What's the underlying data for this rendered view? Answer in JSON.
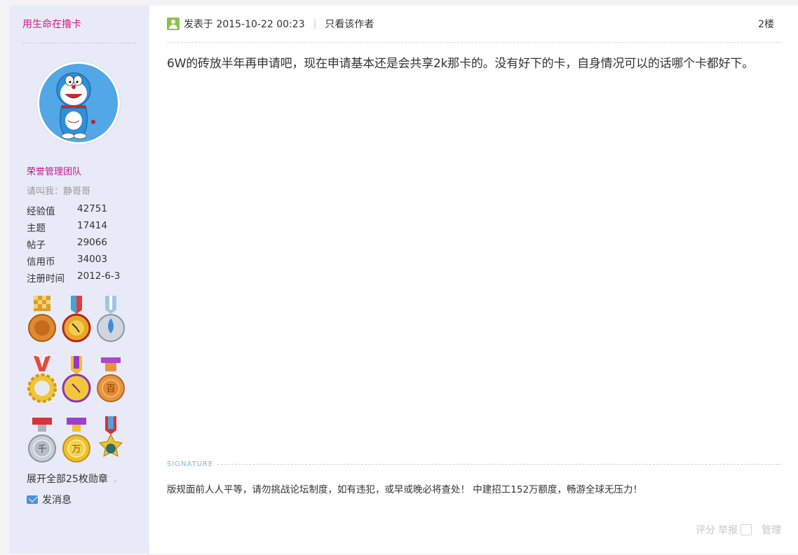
{
  "user": {
    "username": "用生命在撸卡",
    "group": "荣誉管理团队",
    "nickname": "请叫我：静哥哥",
    "stats": [
      {
        "label": "经验值",
        "value": "42751"
      },
      {
        "label": "主题",
        "value": "17414"
      },
      {
        "label": "帖子",
        "value": "29066"
      },
      {
        "label": "信用币",
        "value": "34003"
      },
      {
        "label": "注册时间",
        "value": "2012-6-3"
      }
    ],
    "expand_medals": "展开全部25枚勋章",
    "send_message": "发消息"
  },
  "post": {
    "posted_at": "发表于 2015-10-22 00:23",
    "only_author": "只看该作者",
    "floor": "2楼",
    "content": "6W的砖放半年再申请吧，现在申请基本还是会共享2k那卡的。没有好下的卡，自身情况可以的话哪个卡都好下。",
    "signature_label": "SIGNATURE",
    "signature": "版规面前人人平等，请勿挑战论坛制度，如有违犯，或早或晚必将查处！ 中建招工152万额度，畅游全球无压力！",
    "actions": {
      "rate": "评分",
      "report": "举报",
      "manage": "管理"
    }
  },
  "colors": {
    "sidebar_bg": "#e8ebf7",
    "username": "#d6197e",
    "group": "#c3178b",
    "signature_label": "#7bb8d8"
  },
  "icons": [
    "online-user-icon",
    "mail-icon",
    "chevron-down-icon",
    "doraemon-avatar"
  ]
}
